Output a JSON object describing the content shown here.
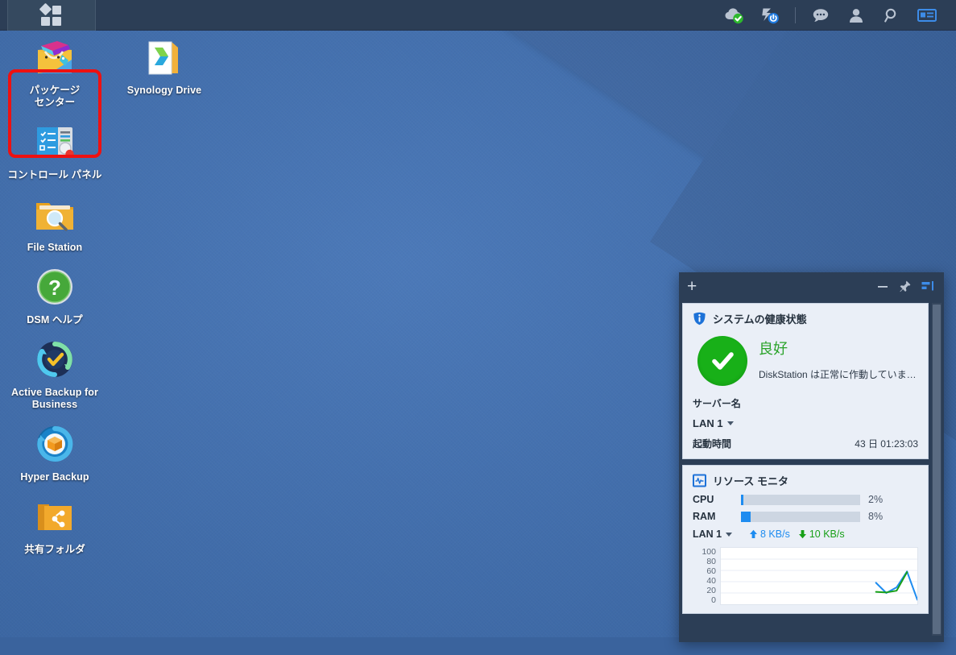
{
  "taskbar": {
    "start_label": "start-menu",
    "tray": [
      {
        "name": "update-status-icon",
        "label": "update-available"
      },
      {
        "name": "power-status-icon",
        "label": "restart-required"
      },
      {
        "name": "notifications-icon",
        "label": "notifications"
      },
      {
        "name": "user-options-icon",
        "label": "personal"
      },
      {
        "name": "search-icon",
        "label": "search"
      },
      {
        "name": "widget-toggle-icon",
        "label": "widgets"
      }
    ]
  },
  "desktop": {
    "column_1": [
      {
        "label": "パッケージ\nセンター",
        "icon": "package-center-icon",
        "name": "package-center"
      },
      {
        "label": "コントロール パネル",
        "icon": "control-panel-icon",
        "name": "control-panel"
      },
      {
        "label": "File Station",
        "icon": "file-station-icon",
        "name": "file-station"
      },
      {
        "label": "DSM ヘルプ",
        "icon": "dsm-help-icon",
        "name": "dsm-help"
      },
      {
        "label": "Active Backup for Business",
        "icon": "active-backup-icon",
        "name": "active-backup-for-business"
      },
      {
        "label": "Hyper Backup",
        "icon": "hyper-backup-icon",
        "name": "hyper-backup"
      },
      {
        "label": "共有フォルダ",
        "icon": "shared-folder-icon",
        "name": "shared-folder"
      }
    ],
    "column_2": [
      {
        "label": "Synology Drive",
        "icon": "synology-drive-icon",
        "name": "synology-drive"
      }
    ],
    "highlight": {
      "target": "package-center",
      "color": "#ee1111"
    }
  },
  "widget_panel": {
    "header": {
      "add_label": "+",
      "minimize_label": "minimize",
      "pin_label": "pin",
      "dock_label": "dock"
    },
    "system_health": {
      "title": "システムの健康状態",
      "status": "良好",
      "status_color": "#2aa32a",
      "description": "DiskStation は正常に作動していま…",
      "server_name_label": "サーバー名",
      "server_name_value": "",
      "lan_label": "LAN 1",
      "uptime_label": "起動時間",
      "uptime_value": "43 日 01:23:03"
    },
    "resource_monitor": {
      "title": "リソース モニタ",
      "cpu_label": "CPU",
      "cpu_value": "2%",
      "cpu_percent": 2,
      "ram_label": "RAM",
      "ram_value": "8%",
      "ram_percent": 8,
      "lan_label": "LAN 1",
      "upload_value": "8 KB/s",
      "download_value": "10 KB/s",
      "upload_color": "#1e8cf0",
      "download_color": "#18a018"
    }
  },
  "chart_data": {
    "type": "line",
    "title": "",
    "xlabel": "",
    "ylabel": "",
    "ylim": [
      0,
      100
    ],
    "yticks": [
      100,
      80,
      60,
      40,
      20,
      0
    ],
    "grid": true,
    "legend": "none",
    "x": [
      0,
      1,
      2,
      3,
      4,
      5,
      6,
      7,
      8,
      9,
      10,
      11,
      12,
      13,
      14,
      15,
      16,
      17,
      18,
      19
    ],
    "series": [
      {
        "name": "upload",
        "color": "#1e8cf0",
        "values": [
          null,
          null,
          null,
          null,
          null,
          null,
          null,
          null,
          null,
          null,
          null,
          null,
          null,
          null,
          null,
          38,
          20,
          30,
          58,
          8
        ]
      },
      {
        "name": "download",
        "color": "#18a018",
        "values": [
          null,
          null,
          null,
          null,
          null,
          null,
          null,
          null,
          null,
          null,
          null,
          null,
          null,
          null,
          null,
          22,
          21,
          24,
          57,
          null
        ]
      }
    ]
  }
}
